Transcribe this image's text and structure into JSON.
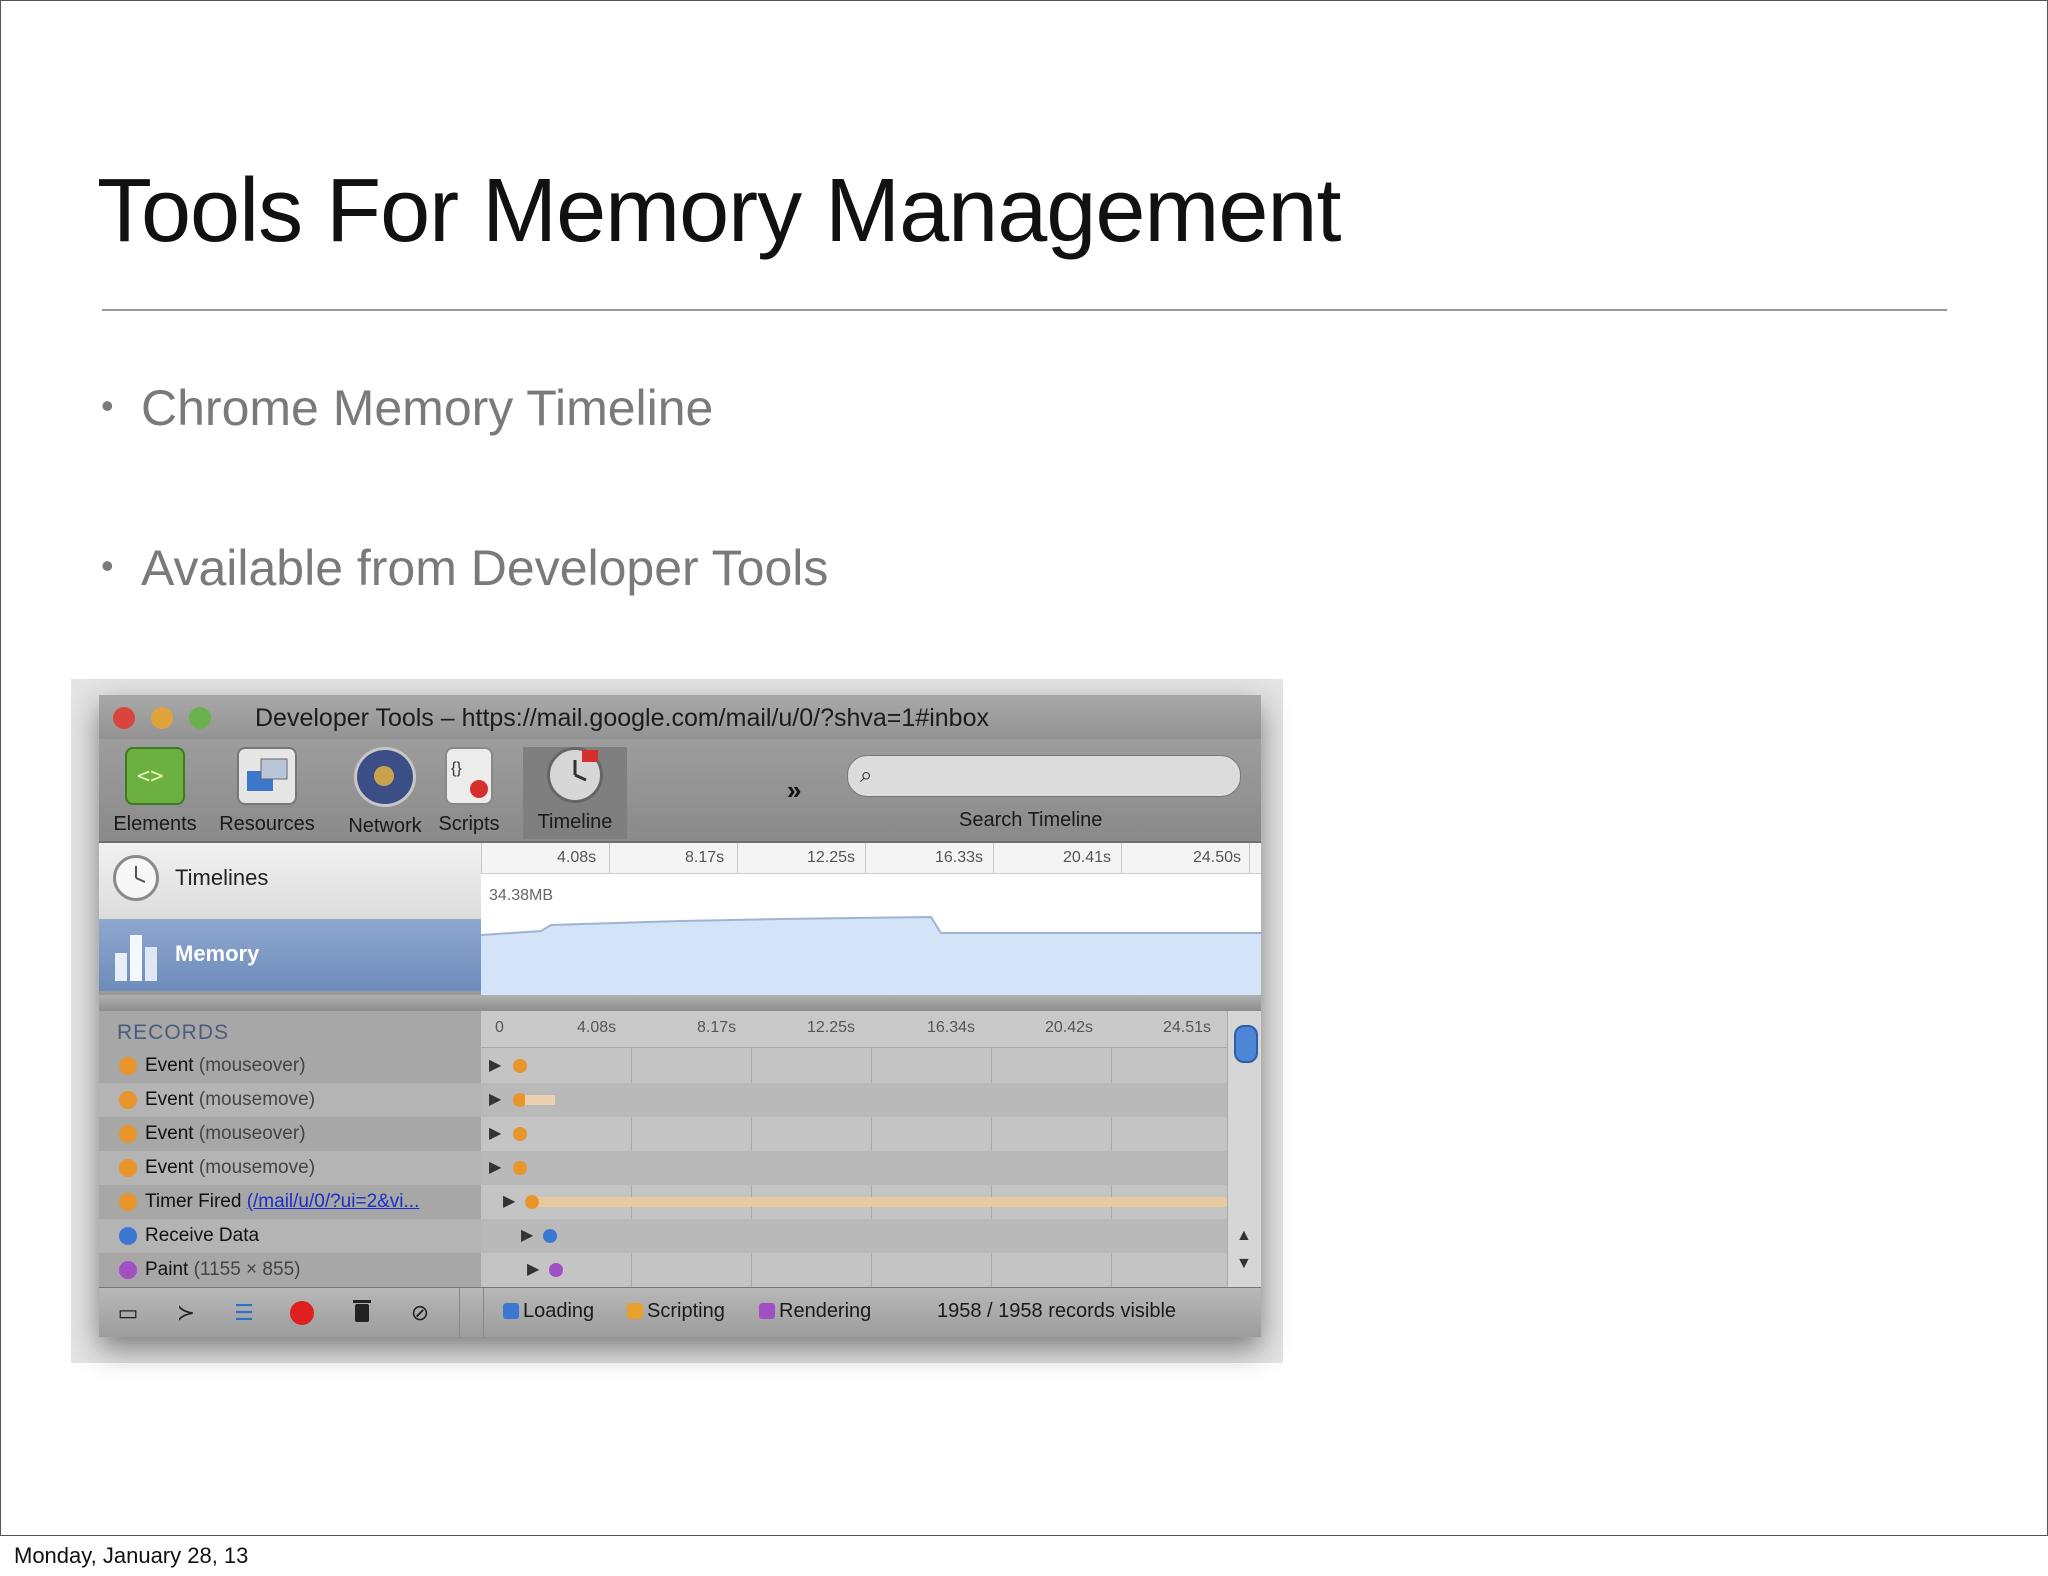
{
  "slide": {
    "title": "Tools For Memory Management",
    "bullets": [
      "Chrome Memory Timeline",
      "Available from Developer Tools"
    ],
    "footer": "Monday, January 28, 13"
  },
  "devtools": {
    "window_title": "Developer Tools – https://mail.google.com/mail/u/0/?shva=1#inbox",
    "toolbar": [
      {
        "label": "Elements",
        "icon": "elements-icon"
      },
      {
        "label": "Resources",
        "icon": "resources-icon"
      },
      {
        "label": "Network",
        "icon": "network-icon"
      },
      {
        "label": "Scripts",
        "icon": "scripts-icon"
      },
      {
        "label": "Timeline",
        "icon": "timeline-icon",
        "selected": true
      }
    ],
    "more_symbol": "»",
    "search_label": "Search Timeline",
    "sidebar": {
      "timelines": "Timelines",
      "memory": "Memory"
    },
    "top_ruler": [
      "4.08s",
      "8.17s",
      "12.25s",
      "16.33s",
      "20.41s",
      "24.50s"
    ],
    "memory_value": "34.38MB",
    "records_header": "RECORDS",
    "records_ruler": [
      "0",
      "4.08s",
      "8.17s",
      "12.25s",
      "16.34s",
      "20.42s",
      "24.51s"
    ],
    "records": [
      {
        "name": "Event",
        "detail": "(mouseover)",
        "color": "#e8952c"
      },
      {
        "name": "Event",
        "detail": "(mousemove)",
        "color": "#e8952c"
      },
      {
        "name": "Event",
        "detail": "(mouseover)",
        "color": "#e8952c"
      },
      {
        "name": "Event",
        "detail": "(mousemove)",
        "color": "#e8952c"
      },
      {
        "name": "Timer Fired",
        "detail": "(/mail/u/0/?ui=2&vi...",
        "color": "#e8952c",
        "link": true
      },
      {
        "name": "Receive Data",
        "detail": "",
        "color": "#3a78d4"
      },
      {
        "name": "Paint",
        "detail": "(1155 × 855)",
        "color": "#a24fc4"
      }
    ],
    "filters": [
      {
        "label": "Loading",
        "color": "#3a78d4"
      },
      {
        "label": "Scripting",
        "color": "#e8a22c"
      },
      {
        "label": "Rendering",
        "color": "#a24fc4"
      }
    ],
    "records_visible": "1958 / 1958 records visible"
  }
}
